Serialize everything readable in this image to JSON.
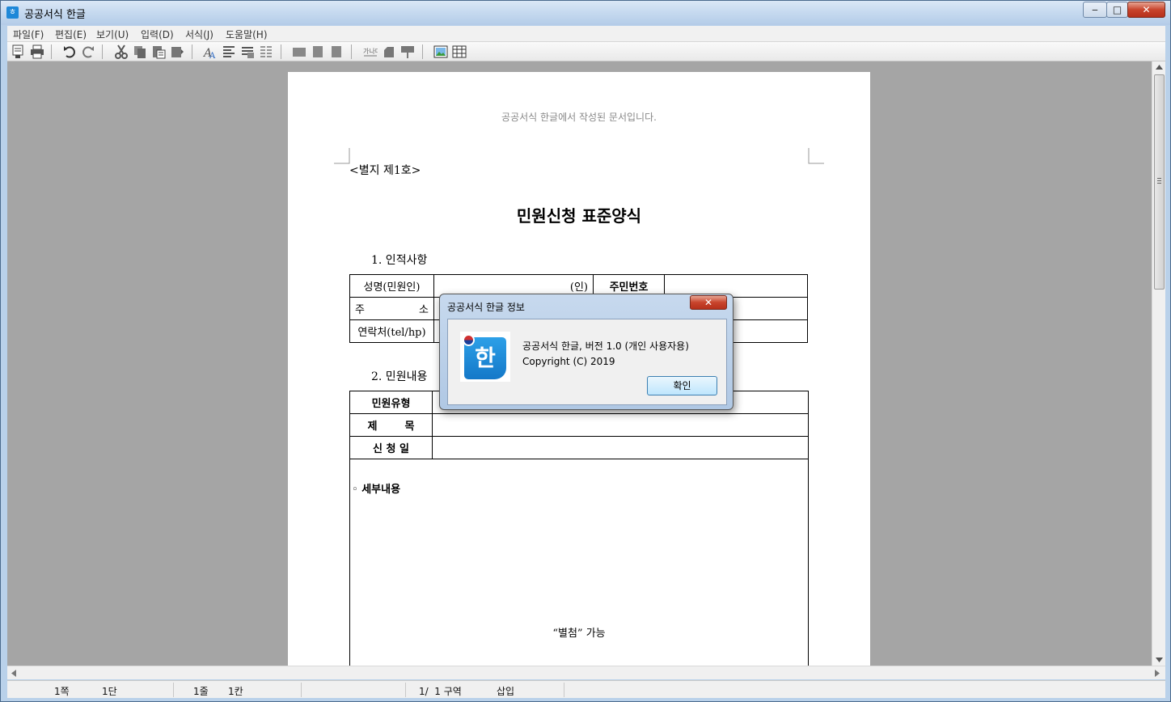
{
  "window": {
    "title": "공공서식 한글",
    "minimize": "‒",
    "maximize": "□",
    "close": "✕"
  },
  "menu": [
    "파일(F)",
    "편집(E)",
    "보기(U)",
    "입력(D)",
    "서식(J)",
    "도움말(H)"
  ],
  "document": {
    "header": "공공서식 한글에서 작성된 문서입니다.",
    "annex": "<별지 제1호>",
    "title": "민원신청 표준양식",
    "section1": "1. 인적사항",
    "section2": "2. 민원내용",
    "personal": {
      "name_label": "성명(민원인)",
      "seal": "(인)",
      "id_label": "주민번호",
      "address_label_1": "주",
      "address_label_2": "소",
      "contact_label": "연락처(tel/hp)"
    },
    "complaint": {
      "type_label": "민원유형",
      "subject_label_1": "제",
      "subject_label_2": "목",
      "date_label": "신 청 일",
      "detail_label": "◦ 세부내용",
      "attachment_note": "“별첨” 가능"
    }
  },
  "dialog": {
    "title": "공공서식 한글 정보",
    "close": "✕",
    "line1": "공공서식 한글, 버전 1.0 (개인 사용자용)",
    "line2": "Copyright (C) 2019",
    "ok": "확인",
    "logo_glyph": "한"
  },
  "status": {
    "page": "1쪽",
    "column": "1단",
    "line": "1줄",
    "char": "1칸",
    "section": "1/  1 구역",
    "mode": "삽입"
  }
}
